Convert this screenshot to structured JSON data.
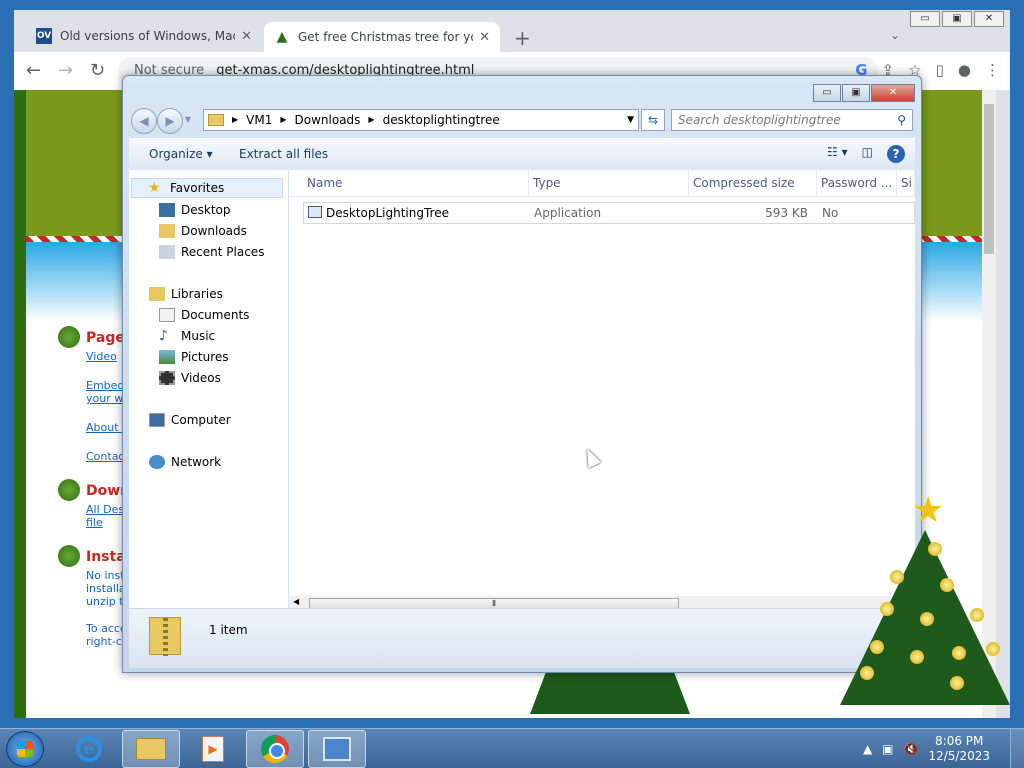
{
  "browser": {
    "tabs": [
      {
        "favicon": "OV",
        "title": "Old versions of Windows, Mac an",
        "close": "✕"
      },
      {
        "favicon": "tree-icon",
        "title": "Get free Christmas tree for your",
        "close": "✕"
      }
    ],
    "new_tab": "+",
    "tab_menu": "⌄",
    "window_controls": [
      "▭",
      "▣",
      "✕"
    ],
    "nav": {
      "back": "←",
      "forward": "→",
      "reload": "↻"
    },
    "omnibox": {
      "security": "Not secure",
      "url": "get-xmas.com/desktoplightingtree.html"
    }
  },
  "webpage": {
    "sections": [
      {
        "heading": "Pages",
        "links": [
          "Video",
          "Embed C",
          "your wel",
          "About Us",
          "Contact"
        ]
      },
      {
        "heading": "Downl",
        "links": [
          "All Deskt",
          "file"
        ]
      },
      {
        "heading": "Install",
        "text": [
          "No instal",
          "installati",
          "unzip the",
          "",
          "To acces",
          "right-clic"
        ]
      }
    ]
  },
  "explorer": {
    "window_controls": {
      "minimize": "▭",
      "maximize": "▣",
      "close": "✕"
    },
    "address": {
      "crumbs": [
        "VM1",
        "Downloads",
        "desktoplightingtree"
      ]
    },
    "search_placeholder": "Search desktoplightingtree",
    "toolbar": {
      "organize": "Organize ▾",
      "extract": "Extract all files",
      "views": "☷ ▾"
    },
    "nav": {
      "favorites": "Favorites",
      "favorites_items": [
        "Desktop",
        "Downloads",
        "Recent Places"
      ],
      "libraries": "Libraries",
      "libraries_items": [
        "Documents",
        "Music",
        "Pictures",
        "Videos"
      ],
      "computer": "Computer",
      "network": "Network"
    },
    "columns": [
      "Name",
      "Type",
      "Compressed size",
      "Password ...",
      "Si"
    ],
    "files": [
      {
        "name": "DesktopLightingTree",
        "type": "Application",
        "size": "593 KB",
        "password": "No"
      }
    ],
    "status": "1 item"
  },
  "taskbar": {
    "clock_time": "8:06 PM",
    "clock_date": "12/5/2023"
  }
}
